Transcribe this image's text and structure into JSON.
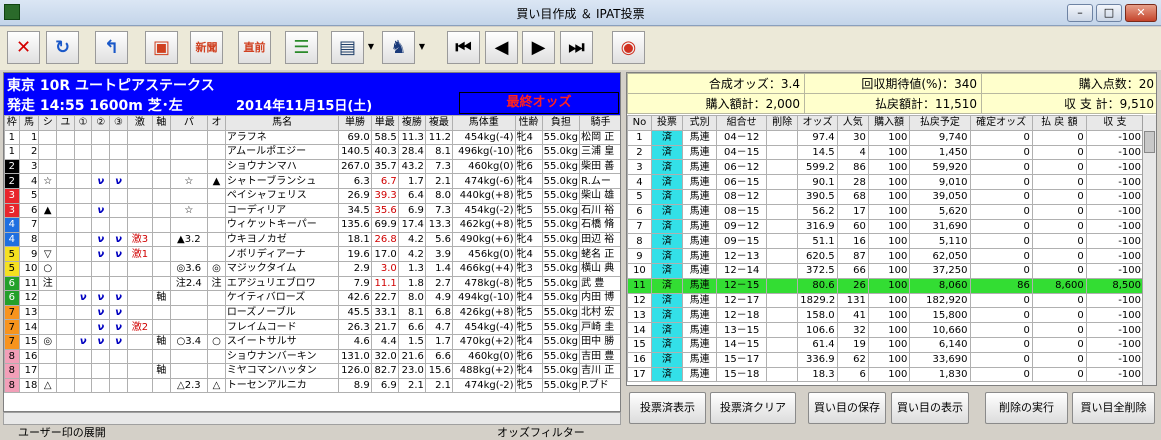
{
  "window": {
    "title": "買い目作成 ＆ IPAT投票",
    "min": "–",
    "max": "□",
    "close": "✕"
  },
  "toolbar": [
    {
      "name": "close-tool-icon",
      "glyph": "✕",
      "color": "#d40000"
    },
    {
      "name": "refresh-icon",
      "glyph": "↻",
      "color": "#1a58c8"
    },
    {
      "name": "return-icon",
      "glyph": "↰",
      "color": "#1a58c8"
    },
    {
      "name": "display-icon",
      "glyph": "▣",
      "color": "#d04020"
    },
    {
      "name": "newspaper-icon",
      "glyph": "新聞",
      "color": "#d04020"
    },
    {
      "name": "pre-race-icon",
      "glyph": "直前",
      "color": "#d04020"
    },
    {
      "name": "list-icon",
      "glyph": "☰",
      "color": "#2a8a2a"
    },
    {
      "name": "ticket-icon",
      "glyph": "▤",
      "color": "#20406a"
    },
    {
      "name": "horse-check-icon",
      "glyph": "♞",
      "color": "#1a3a7a"
    },
    {
      "name": "first-icon",
      "glyph": "⏮",
      "color": "#000"
    },
    {
      "name": "prev-icon",
      "glyph": "◀",
      "color": "#000"
    },
    {
      "name": "next-icon",
      "glyph": "▶",
      "color": "#000"
    },
    {
      "name": "last-icon",
      "glyph": "⏭",
      "color": "#000"
    },
    {
      "name": "logo-icon",
      "glyph": "◉",
      "color": "#d03020"
    }
  ],
  "race": {
    "line1": "東京 10R ユートピアステークス",
    "line2": "発走 14:55 1600m 芝･左",
    "date": "2014年11月15日(土)",
    "odds_label": "最終オッズ"
  },
  "left_headers": [
    "枠",
    "馬",
    "シ",
    "ユ",
    "①",
    "②",
    "③",
    "激",
    "軸",
    "パ",
    "オ",
    "馬名",
    "単勝",
    "単最",
    "複勝",
    "複最",
    "馬体重",
    "性齢",
    "負担",
    "騎手"
  ],
  "horses": [
    [
      "1",
      "1",
      "",
      "",
      "",
      "",
      "",
      "",
      "",
      "",
      "",
      "アラフネ",
      "69.0",
      "58.5",
      "11.3",
      "11.2",
      "454kg(-4)",
      "牝4",
      "55.0kg",
      "松岡 正"
    ],
    [
      "1",
      "2",
      "",
      "",
      "",
      "",
      "",
      "",
      "",
      "",
      "",
      "アムールポエジー",
      "140.5",
      "40.3",
      "28.4",
      "8.1",
      "496kg(-10)",
      "牝6",
      "55.0kg",
      "三浦 皇"
    ],
    [
      "2",
      "3",
      "",
      "",
      "",
      "",
      "",
      "",
      "",
      "",
      "",
      "ショウナンマハ",
      "267.0",
      "35.7",
      "43.2",
      "7.3",
      "460kg(0)",
      "牝6",
      "55.0kg",
      "柴田 善"
    ],
    [
      "2",
      "4",
      "☆",
      "",
      "",
      "ν",
      "ν",
      "",
      "",
      "☆",
      "▲",
      "シャトーブランシュ",
      "6.3",
      "6.7",
      "1.7",
      "2.1",
      "474kg(-6)",
      "牝4",
      "55.0kg",
      "R.ムー"
    ],
    [
      "3",
      "5",
      "",
      "",
      "",
      "",
      "",
      "",
      "",
      "",
      "",
      "ペイシャフェリス",
      "26.9",
      "39.3",
      "6.4",
      "8.0",
      "440kg(+8)",
      "牝5",
      "55.0kg",
      "柴山 雄"
    ],
    [
      "3",
      "6",
      "▲",
      "",
      "",
      "ν",
      "",
      "",
      "",
      "☆",
      "",
      "コーディリア",
      "34.5",
      "35.6",
      "6.9",
      "7.3",
      "454kg(-2)",
      "牝5",
      "55.0kg",
      "石川 裕"
    ],
    [
      "4",
      "7",
      "",
      "",
      "",
      "",
      "",
      "",
      "",
      "",
      "",
      "ウィケットキーパー",
      "135.6",
      "69.9",
      "17.4",
      "13.3",
      "462kg(+8)",
      "牝5",
      "55.0kg",
      "石橋 脩"
    ],
    [
      "4",
      "8",
      "",
      "",
      "",
      "ν",
      "ν",
      "激3",
      "",
      "▲3.2",
      "",
      "ウキヨノカゼ",
      "18.1",
      "26.8",
      "4.2",
      "5.6",
      "490kg(+6)",
      "牝4",
      "55.0kg",
      "田辺 裕"
    ],
    [
      "5",
      "9",
      "▽",
      "",
      "",
      "ν",
      "ν",
      "激1",
      "",
      "",
      "",
      "ノボリディアーナ",
      "19.6",
      "17.0",
      "4.2",
      "3.9",
      "456kg(0)",
      "牝4",
      "55.0kg",
      "蛯名 正"
    ],
    [
      "5",
      "10",
      "○",
      "",
      "",
      "",
      "",
      "",
      "",
      "◎3.6",
      "◎",
      "マジックタイム",
      "2.9",
      "3.0",
      "1.3",
      "1.4",
      "466kg(+4)",
      "牝3",
      "55.0kg",
      "横山 典"
    ],
    [
      "6",
      "11",
      "注",
      "",
      "",
      "",
      "",
      "",
      "",
      "注2.4",
      "注",
      "エアジュリエブロワ",
      "7.9",
      "11.1",
      "1.8",
      "2.7",
      "478kg(-8)",
      "牝5",
      "55.0kg",
      "武 豊"
    ],
    [
      "6",
      "12",
      "",
      "",
      "ν",
      "ν",
      "ν",
      "",
      "軸",
      "",
      "",
      "ケイティバローズ",
      "42.6",
      "22.7",
      "8.0",
      "4.9",
      "494kg(-10)",
      "牝4",
      "55.0kg",
      "内田 博"
    ],
    [
      "7",
      "13",
      "",
      "",
      "",
      "ν",
      "ν",
      "",
      "",
      "",
      "",
      "ローズノーブル",
      "45.5",
      "33.1",
      "8.1",
      "6.8",
      "426kg(+8)",
      "牝5",
      "55.0kg",
      "北村 宏"
    ],
    [
      "7",
      "14",
      "",
      "",
      "",
      "ν",
      "ν",
      "激2",
      "",
      "",
      "",
      "フレイムコード",
      "26.3",
      "21.7",
      "6.6",
      "4.7",
      "454kg(-4)",
      "牝5",
      "55.0kg",
      "戸崎 圭"
    ],
    [
      "7",
      "15",
      "◎",
      "",
      "ν",
      "ν",
      "ν",
      "",
      "軸",
      "○3.4",
      "○",
      "スイートサルサ",
      "4.6",
      "4.4",
      "1.5",
      "1.7",
      "470kg(+2)",
      "牝4",
      "55.0kg",
      "田中 勝"
    ],
    [
      "8",
      "16",
      "",
      "",
      "",
      "",
      "",
      "",
      "",
      "",
      "",
      "ショウナンバーキン",
      "131.0",
      "32.0",
      "21.6",
      "6.6",
      "460kg(0)",
      "牝6",
      "55.0kg",
      "吉田 豊"
    ],
    [
      "8",
      "17",
      "",
      "",
      "",
      "",
      "",
      "",
      "軸",
      "",
      "",
      "ミヤコマンハッタン",
      "126.0",
      "82.7",
      "23.0",
      "15.6",
      "488kg(+2)",
      "牝4",
      "55.0kg",
      "吉川 正"
    ],
    [
      "8",
      "18",
      "△",
      "",
      "",
      "",
      "",
      "",
      "",
      "△2.3",
      "△",
      "トーセンアルニカ",
      "8.9",
      "6.9",
      "2.1",
      "2.1",
      "474kg(-2)",
      "牝5",
      "55.0kg",
      "P.ブド"
    ]
  ],
  "summary": {
    "goseiodds": "合成オッズ：3.4",
    "kaishu": "回収期待値(%)：340",
    "kounyu_points": "購入点数：20",
    "kounyu_amount": "購入額計：2,000",
    "harai_amount": "払戻額計：11,510",
    "shushi": "収 支 計：9,510"
  },
  "right_headers": [
    "No",
    "投票",
    "式別",
    "組合せ",
    "削除",
    "オッズ",
    "人気",
    "購入額",
    "払戻予定",
    "確定オッズ",
    "払 戻 額",
    "収 支"
  ],
  "bets": [
    [
      "1",
      "済",
      "馬連",
      "04－12",
      "",
      "97.4",
      "30",
      "100",
      "9,740",
      "0",
      "0",
      "-100"
    ],
    [
      "2",
      "済",
      "馬連",
      "04－15",
      "",
      "14.5",
      "4",
      "100",
      "1,450",
      "0",
      "0",
      "-100"
    ],
    [
      "3",
      "済",
      "馬連",
      "06－12",
      "",
      "599.2",
      "86",
      "100",
      "59,920",
      "0",
      "0",
      "-100"
    ],
    [
      "4",
      "済",
      "馬連",
      "06－15",
      "",
      "90.1",
      "28",
      "100",
      "9,010",
      "0",
      "0",
      "-100"
    ],
    [
      "5",
      "済",
      "馬連",
      "08－12",
      "",
      "390.5",
      "68",
      "100",
      "39,050",
      "0",
      "0",
      "-100"
    ],
    [
      "6",
      "済",
      "馬連",
      "08－15",
      "",
      "56.2",
      "17",
      "100",
      "5,620",
      "0",
      "0",
      "-100"
    ],
    [
      "7",
      "済",
      "馬連",
      "09－12",
      "",
      "316.9",
      "60",
      "100",
      "31,690",
      "0",
      "0",
      "-100"
    ],
    [
      "8",
      "済",
      "馬連",
      "09－15",
      "",
      "51.1",
      "16",
      "100",
      "5,110",
      "0",
      "0",
      "-100"
    ],
    [
      "9",
      "済",
      "馬連",
      "12－13",
      "",
      "620.5",
      "87",
      "100",
      "62,050",
      "0",
      "0",
      "-100"
    ],
    [
      "10",
      "済",
      "馬連",
      "12－14",
      "",
      "372.5",
      "66",
      "100",
      "37,250",
      "0",
      "0",
      "-100"
    ],
    [
      "11",
      "済",
      "馬連",
      "12－15",
      "",
      "80.6",
      "26",
      "100",
      "8,060",
      "86",
      "8,600",
      "8,500"
    ],
    [
      "12",
      "済",
      "馬連",
      "12－17",
      "",
      "1829.2",
      "131",
      "100",
      "182,920",
      "0",
      "0",
      "-100"
    ],
    [
      "13",
      "済",
      "馬連",
      "12－18",
      "",
      "158.0",
      "41",
      "100",
      "15,800",
      "0",
      "0",
      "-100"
    ],
    [
      "14",
      "済",
      "馬連",
      "13－15",
      "",
      "106.6",
      "32",
      "100",
      "10,660",
      "0",
      "0",
      "-100"
    ],
    [
      "15",
      "済",
      "馬連",
      "14－15",
      "",
      "61.4",
      "19",
      "100",
      "6,140",
      "0",
      "0",
      "-100"
    ],
    [
      "16",
      "済",
      "馬連",
      "15－17",
      "",
      "336.9",
      "62",
      "100",
      "33,690",
      "0",
      "0",
      "-100"
    ],
    [
      "17",
      "済",
      "馬連",
      "15－18",
      "",
      "18.3",
      "6",
      "100",
      "1,830",
      "0",
      "0",
      "-100"
    ]
  ],
  "buttons": {
    "show_voted": "投票済表示",
    "clear_voted": "投票済クリア",
    "save": "買い目の保存",
    "show": "買い目の表示",
    "delete_exec": "削除の実行",
    "delete_all": "買い目全削除"
  },
  "bottom": {
    "user_mark": "ユーザー印の展開",
    "odds_filter": "オッズフィルター"
  },
  "colors": {
    "waku": [
      "#ffffff",
      "#000000",
      "#e8252c",
      "#1f6fe0",
      "#f5e020",
      "#23a02a",
      "#f7941d",
      "#f29fb8"
    ],
    "highlight": "#33dd33",
    "voted": "#33e0e8",
    "race_header": "#0000ff",
    "summary": "#ffffcc"
  }
}
